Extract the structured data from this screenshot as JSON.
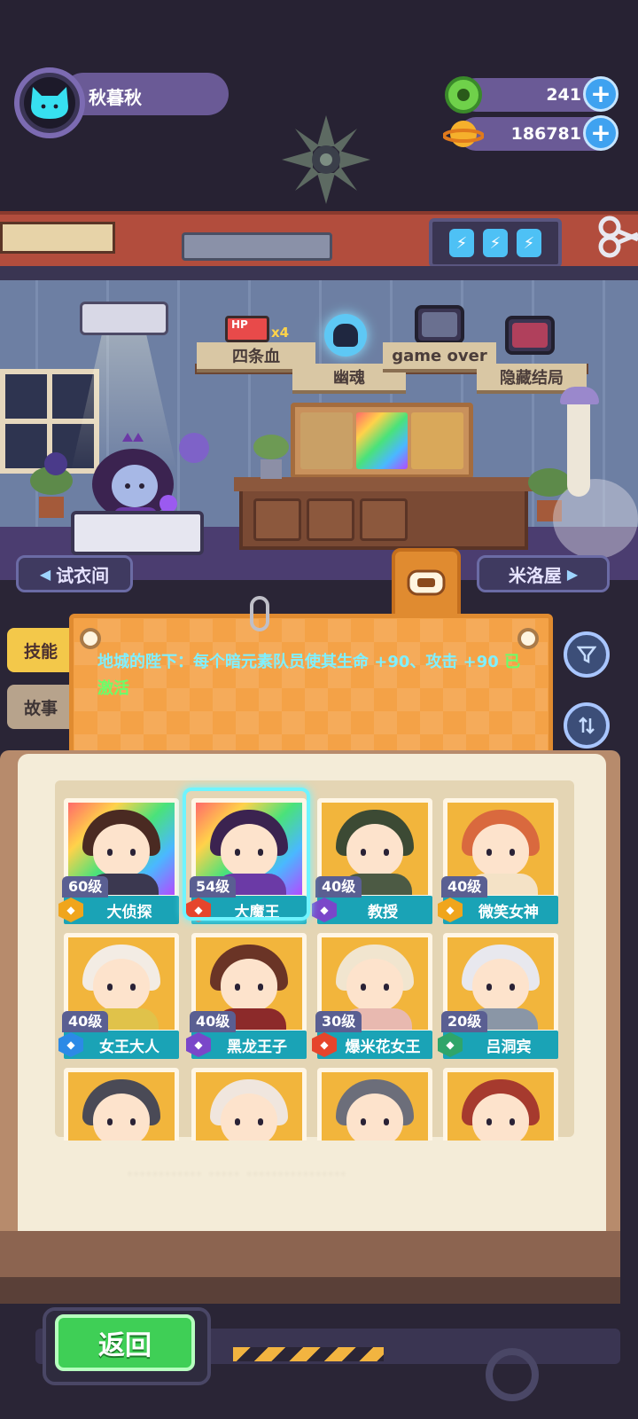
{
  "player": {
    "name": "秋暮秋"
  },
  "currency": [
    {
      "icon": "green-gem-icon",
      "value": "241",
      "color": "#6fd14a"
    },
    {
      "icon": "gold-planet-coin-icon",
      "value": "186781",
      "color": "#f5b02c"
    }
  ],
  "room": {
    "plaques": [
      "四条血",
      "幽魂",
      "game over",
      "隐藏结局"
    ],
    "hp_badge": "HP",
    "hp_multiplier": "x4",
    "nav_left": "试衣间",
    "nav_right": "米洛屋"
  },
  "tabs": [
    "技能",
    "故事"
  ],
  "skill": {
    "text": "地城的陛下：每个暗元素队员使其生命 +90、攻击 +90",
    "status": "已激活"
  },
  "heroes": [
    {
      "name": "大侦探",
      "level": "60级",
      "element": "gold",
      "elemColor": "#f0a51c",
      "bg": "rainbow",
      "hair": "#4a2a22",
      "outfit": "#3b3850"
    },
    {
      "name": "大魔王",
      "level": "54级",
      "element": "fire",
      "elemColor": "#e6452c",
      "bg": "rainbow",
      "hair": "#3b2350",
      "outfit": "#6b3aa6",
      "selected": true
    },
    {
      "name": "教授",
      "level": "40级",
      "element": "dark",
      "elemColor": "#7a47c9",
      "bg": "gold",
      "hair": "#3c4a34",
      "outfit": "#4c5a44"
    },
    {
      "name": "微笑女神",
      "level": "40级",
      "element": "gold",
      "elemColor": "#f0a51c",
      "bg": "gold",
      "hair": "#d9693e",
      "outfit": "#f4e2c6"
    },
    {
      "name": "女王大人",
      "level": "40级",
      "element": "water",
      "elemColor": "#2c8ae6",
      "bg": "gold",
      "hair": "#f3ece4",
      "outfit": "#e0c24a"
    },
    {
      "name": "黑龙王子",
      "level": "40级",
      "element": "dark",
      "elemColor": "#7a47c9",
      "bg": "gold",
      "hair": "#6a3426",
      "outfit": "#8c2a2a"
    },
    {
      "name": "爆米花女王",
      "level": "30级",
      "element": "fire",
      "elemColor": "#e6452c",
      "bg": "gold",
      "hair": "#f1e5cf",
      "outfit": "#e8b9b0"
    },
    {
      "name": "吕洞宾",
      "level": "20级",
      "element": "wood",
      "elemColor": "#2fa56a",
      "bg": "gold",
      "hair": "#e8e8ee",
      "outfit": "#8a96a6"
    },
    {
      "name": "",
      "level": "",
      "bg": "gold",
      "hair": "#4a4a56",
      "outfit": "#6a6a7a"
    },
    {
      "name": "",
      "level": "",
      "bg": "gold",
      "hair": "#f0e6de",
      "outfit": "#bfd8de"
    },
    {
      "name": "",
      "level": "",
      "bg": "gold",
      "hair": "#6c6e7a",
      "outfit": "#4c4c58"
    },
    {
      "name": "",
      "level": "",
      "bg": "gold",
      "hair": "#a63a2e",
      "outfit": "#7a2a22"
    }
  ],
  "footer": {
    "back_label": "返回"
  },
  "colors": {
    "accent_cyan": "#7ff0ff",
    "active_green": "#6aff6a",
    "board_orange": "#f4a247"
  }
}
